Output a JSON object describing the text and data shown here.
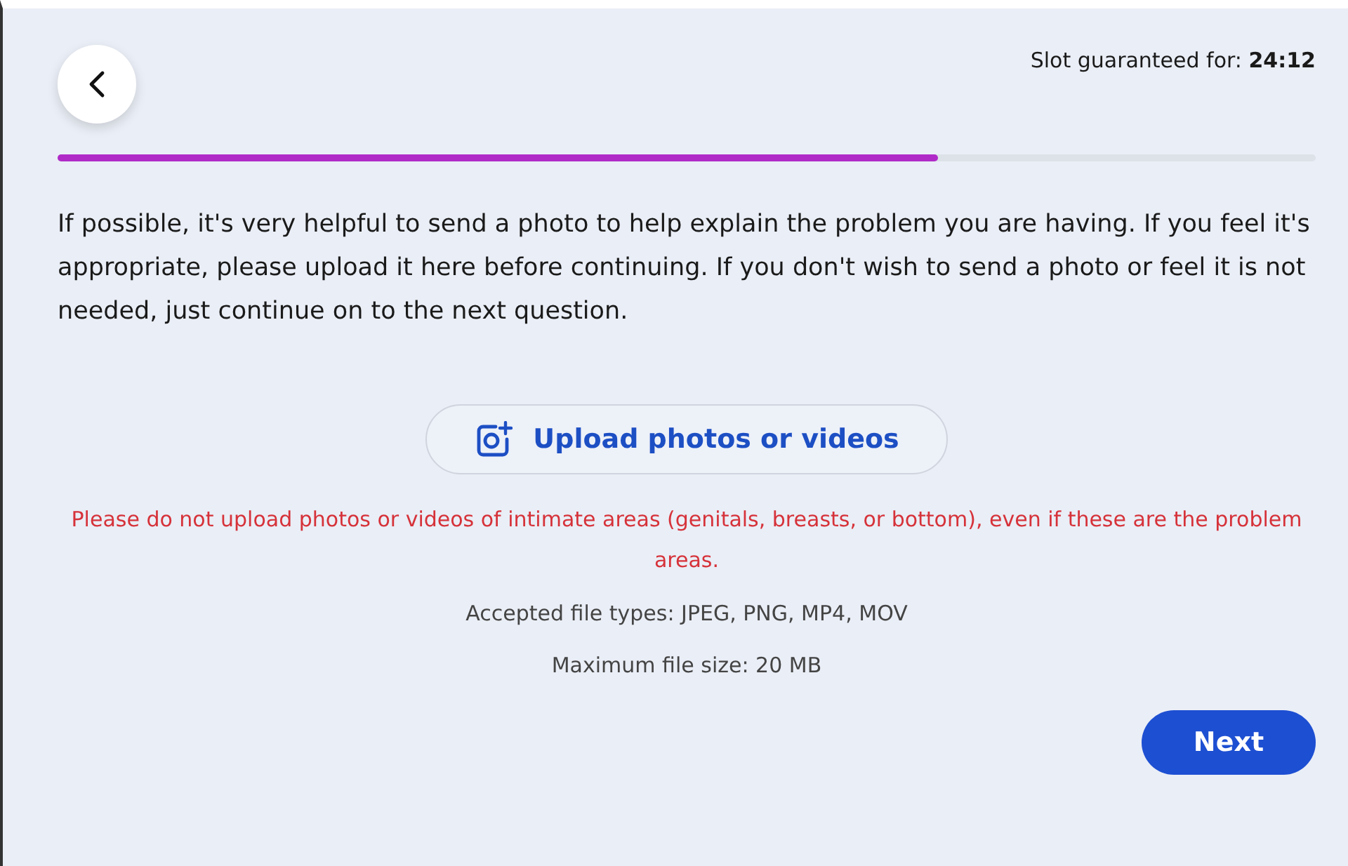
{
  "timer": "Slot guaranteed for: **24:12**",
  "progress": {
    "level": 0.7
  },
  "intro": "If possible, it's very helpful to send a photo to help explain the problem you are having. If you feel it's appropriate, please upload it here before continuing. If you don't wish to send a photo or feel it is not needed, just continue on to the next question.",
  "upload_button": "Upload photos or videos",
  "warning": "Please do not upload photos or videos of intimate areas (genitals, breasts, or bottom), even if these are the problem areas.",
  "notes": [
    "Accepted file types: JPEG, PNG, MP4, MOV",
    "Maximum file size: 20 MB"
  ],
  "next_button": "Next"
}
